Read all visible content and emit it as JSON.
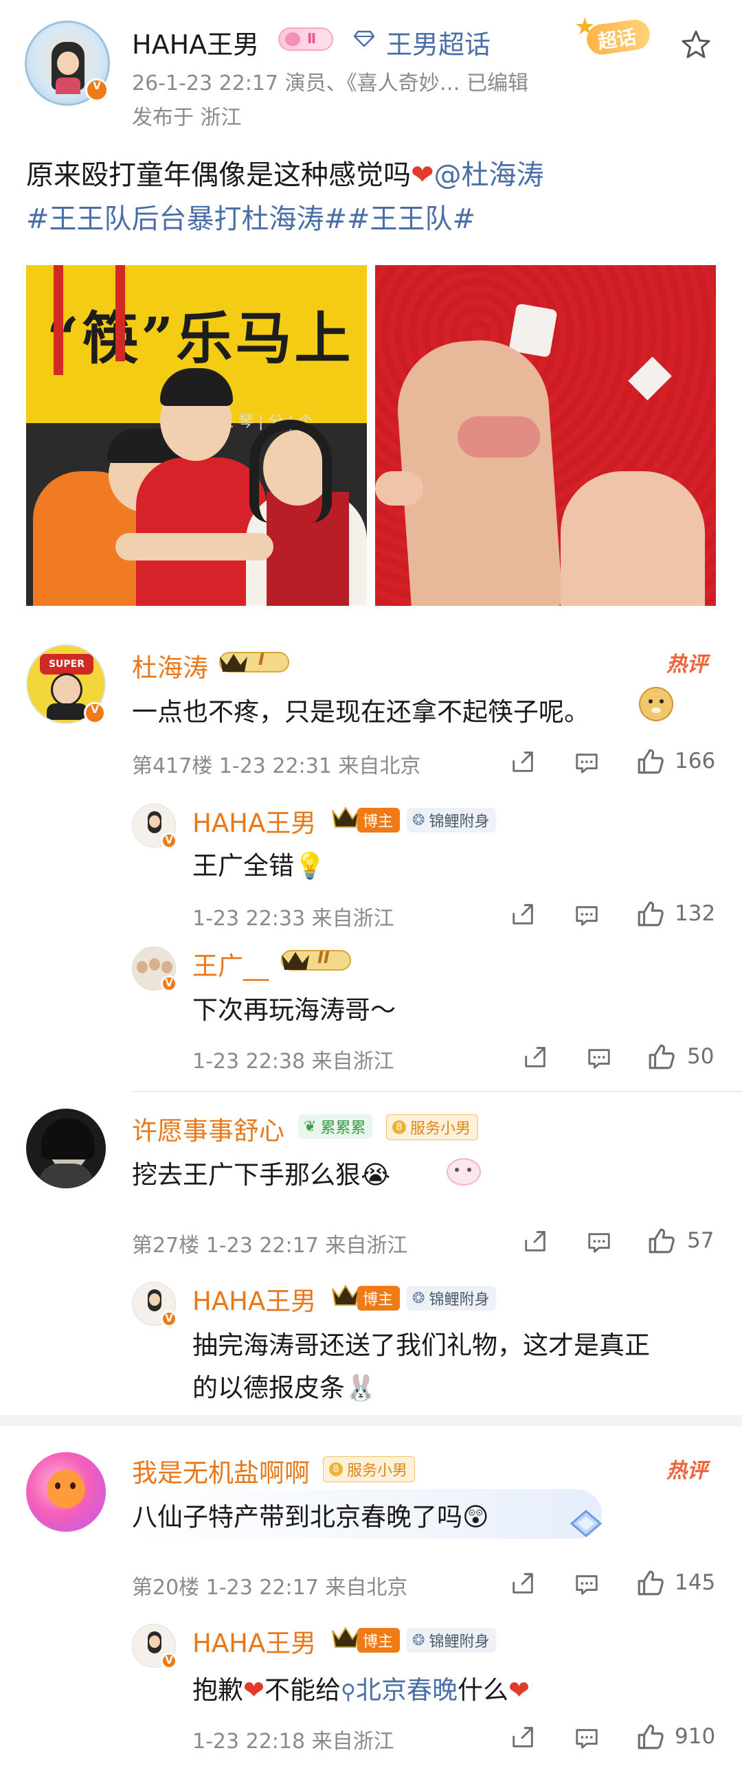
{
  "post": {
    "author": "HAHA王男",
    "time_source": "26-1-23 22:17  演员、《喜人奇妙…  已编辑",
    "location": "发布于 浙江",
    "super_topic_link": "王男超话",
    "super_topic_badge": "超话",
    "body_text": "原来殴打童年偶像是这种感觉吗",
    "mention": "@杜海涛",
    "hashtags": "#王王队后台暴打杜海涛##王王队#",
    "photo1_sign": "“筷”乐马上",
    "photo1_board": "王 琴 | 分 | 个"
  },
  "comments": [
    {
      "user": "杜海涛",
      "level": "I",
      "hot_badge": "热评",
      "text": "一点也不疼，只是现在还拿不起筷子呢。",
      "meta": "第417楼 1-23 22:31 来自北京",
      "likes": "166",
      "replies": [
        {
          "user": "HAHA王男",
          "role": "博主",
          "tag": "锦鲤附身",
          "text": "王广全错",
          "meta": "1-23 22:33 来自浙江",
          "likes": "132"
        },
        {
          "user": "王广__",
          "level": "II",
          "text": "下次再玩海涛哥～",
          "meta": "1-23 22:38 来自浙江",
          "likes": "50"
        }
      ]
    },
    {
      "user": "许愿事事舒心",
      "tag1": "累累累",
      "tag2": "服务小男",
      "text": "挖去王广下手那么狠",
      "meta": "第27楼 1-23 22:17 来自浙江",
      "likes": "57",
      "replies": [
        {
          "user": "HAHA王男",
          "role": "博主",
          "tag": "锦鲤附身",
          "text1": "抽完海涛哥还送了我们礼物，这才是真正",
          "text2": "的以德报皮条"
        }
      ]
    },
    {
      "user": "我是无机盐啊啊",
      "tag": "服务小男",
      "hot_badge": "热评",
      "text": "八仙子特产带到北京春晚了吗",
      "meta": "第20楼 1-23 22:17 来自北京",
      "likes": "145",
      "replies": [
        {
          "user": "HAHA王男",
          "role": "博主",
          "tag": "锦鲤附身",
          "text_a": "抱歉",
          "text_b": "不能给",
          "search": "北京春晚",
          "text_c": "什么",
          "meta": "1-23 22:18 来自浙江",
          "likes": "910"
        }
      ]
    }
  ],
  "colors": {
    "name_orange": "#e8781a",
    "link_blue": "#4a6fa8",
    "meta_gray": "#8a8a8a",
    "hot_red": "#f0623a"
  }
}
